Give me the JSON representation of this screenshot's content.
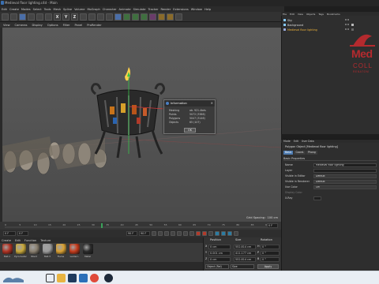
{
  "window": {
    "title": "Medieval floor lighting.c4d - Main"
  },
  "menubar": [
    "Edit",
    "Create",
    "Modes",
    "Select",
    "Tools",
    "Mesh",
    "Spline",
    "Volume",
    "MoGraph",
    "Character",
    "Animate",
    "Simulate",
    "Tracker",
    "Render",
    "Extensions",
    "Window",
    "Help"
  ],
  "toolbar": {
    "axis_x": "X",
    "axis_y": "Y",
    "axis_z": "Z"
  },
  "viewport_menu": [
    "View",
    "Cameras",
    "Display",
    "Options",
    "Filter",
    "Panel",
    "ProRender"
  ],
  "viewport": {
    "grid_spacing": "Grid Spacing : 100 cm"
  },
  "timeline": {
    "ticks": [
      "0",
      "5",
      "10",
      "15",
      "20",
      "25",
      "30",
      "35",
      "40",
      "45",
      "50",
      "55",
      "60",
      "65",
      "70",
      "75",
      "80",
      "85",
      "90"
    ],
    "end": "0 F"
  },
  "transport": {
    "start": "0 F",
    "current": "0 F",
    "end": "90 F",
    "end2": "90 F"
  },
  "materials_menu": [
    "Create",
    "Edit",
    "Function",
    "Texture"
  ],
  "materials": [
    {
      "label": "Mat.1",
      "color": "#b03222"
    },
    {
      "label": "Pyrocluster",
      "color": "#c8a83a"
    },
    {
      "label": "Wood",
      "color": "#8a8070"
    },
    {
      "label": "Mat.3",
      "color": "#9b9b9b"
    },
    {
      "label": "Flame",
      "color": "#d9a032"
    },
    {
      "label": "Lantern",
      "color": "#c43a1a"
    },
    {
      "label": "Metal",
      "color": "#2a2a2a"
    }
  ],
  "coords": {
    "headers": {
      "position": "Position",
      "size": "Size",
      "rotation": "Rotation"
    },
    "rows": [
      {
        "axis": "X",
        "pos": "0 cm",
        "size": "552.814 cm",
        "rax": "H",
        "rot": "0 °"
      },
      {
        "axis": "Y",
        "pos": "0.001 cm",
        "size": "411.177 cm",
        "rax": "P",
        "rot": "0 °"
      },
      {
        "axis": "Z",
        "pos": "0 cm",
        "size": "552.814 cm",
        "rax": "B",
        "rot": "0 °"
      }
    ],
    "mode1": "Object (Rel)",
    "mode2": "Size",
    "apply": "Apply"
  },
  "right_tabs": [
    "Objects",
    "Takes",
    "Content Browser",
    "Structure",
    "Layers",
    "Attributes"
  ],
  "objects_menu": [
    "File",
    "Edit",
    "View",
    "Objects",
    "Tags",
    "Bookmarks"
  ],
  "objects": [
    {
      "name": "Sky",
      "highlight": false
    },
    {
      "name": "Background",
      "highlight": false
    },
    {
      "name": "Medieval floor lighting",
      "highlight": true
    }
  ],
  "logo": {
    "line1": "Med",
    "line2": "COLL",
    "line3": "RENATOM"
  },
  "attr_menu": [
    "Mode",
    "Edit",
    "User Data"
  ],
  "attr": {
    "title": "Polygon Object [Medieval floor lighting]",
    "tabs": [
      "Basic",
      "Coord.",
      "Phong"
    ],
    "section": "Basic Properties",
    "rows": [
      {
        "label": "Name",
        "value": "Medieval floor lighting"
      },
      {
        "label": "Layer",
        "value": ""
      },
      {
        "label": "Visible in Editor",
        "value": "Default"
      },
      {
        "label": "Visible in Renderer",
        "value": "Default"
      },
      {
        "label": "Use Color",
        "value": "Off"
      },
      {
        "label": "Display Color",
        "value": ""
      },
      {
        "label": "X-Ray",
        "value": ""
      }
    ]
  },
  "dialog": {
    "title": "Information",
    "rows": [
      {
        "k": "Meshing",
        "v": "ab. 921-4bds"
      },
      {
        "k": "Points",
        "v": "5072 (3386)"
      },
      {
        "k": "Polygons",
        "v": "5047 (3146)"
      },
      {
        "k": "Objects",
        "v": "65 (107)"
      }
    ],
    "ok": "OK"
  },
  "colors": {
    "accent": "#4e7bb0",
    "highlight": "#f0b43a",
    "logo": "#b42a2e"
  }
}
